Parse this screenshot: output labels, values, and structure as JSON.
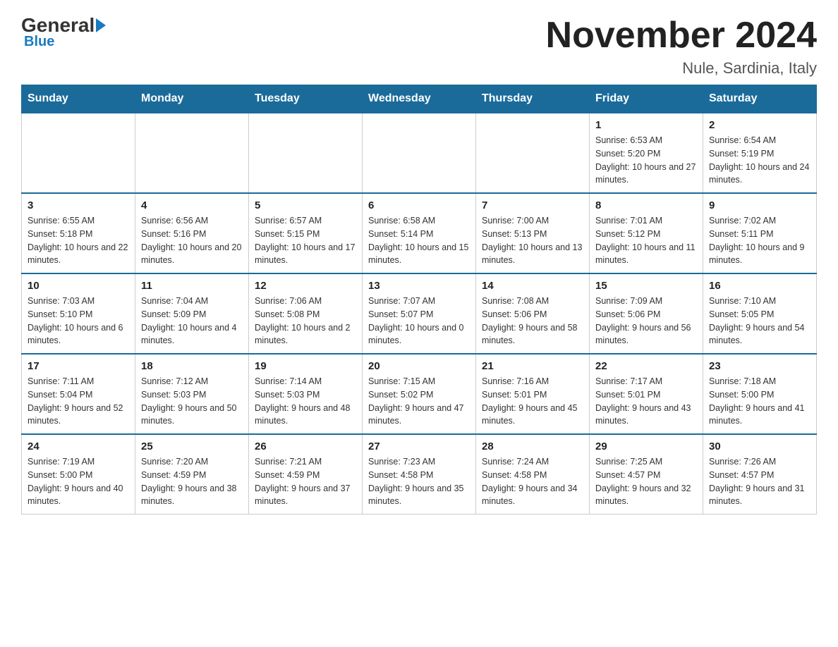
{
  "logo": {
    "general": "General",
    "blue": "Blue"
  },
  "header": {
    "month_year": "November 2024",
    "location": "Nule, Sardinia, Italy"
  },
  "days_of_week": [
    "Sunday",
    "Monday",
    "Tuesday",
    "Wednesday",
    "Thursday",
    "Friday",
    "Saturday"
  ],
  "weeks": [
    {
      "days": [
        {
          "num": "",
          "info": ""
        },
        {
          "num": "",
          "info": ""
        },
        {
          "num": "",
          "info": ""
        },
        {
          "num": "",
          "info": ""
        },
        {
          "num": "",
          "info": ""
        },
        {
          "num": "1",
          "info": "Sunrise: 6:53 AM\nSunset: 5:20 PM\nDaylight: 10 hours and 27 minutes."
        },
        {
          "num": "2",
          "info": "Sunrise: 6:54 AM\nSunset: 5:19 PM\nDaylight: 10 hours and 24 minutes."
        }
      ]
    },
    {
      "days": [
        {
          "num": "3",
          "info": "Sunrise: 6:55 AM\nSunset: 5:18 PM\nDaylight: 10 hours and 22 minutes."
        },
        {
          "num": "4",
          "info": "Sunrise: 6:56 AM\nSunset: 5:16 PM\nDaylight: 10 hours and 20 minutes."
        },
        {
          "num": "5",
          "info": "Sunrise: 6:57 AM\nSunset: 5:15 PM\nDaylight: 10 hours and 17 minutes."
        },
        {
          "num": "6",
          "info": "Sunrise: 6:58 AM\nSunset: 5:14 PM\nDaylight: 10 hours and 15 minutes."
        },
        {
          "num": "7",
          "info": "Sunrise: 7:00 AM\nSunset: 5:13 PM\nDaylight: 10 hours and 13 minutes."
        },
        {
          "num": "8",
          "info": "Sunrise: 7:01 AM\nSunset: 5:12 PM\nDaylight: 10 hours and 11 minutes."
        },
        {
          "num": "9",
          "info": "Sunrise: 7:02 AM\nSunset: 5:11 PM\nDaylight: 10 hours and 9 minutes."
        }
      ]
    },
    {
      "days": [
        {
          "num": "10",
          "info": "Sunrise: 7:03 AM\nSunset: 5:10 PM\nDaylight: 10 hours and 6 minutes."
        },
        {
          "num": "11",
          "info": "Sunrise: 7:04 AM\nSunset: 5:09 PM\nDaylight: 10 hours and 4 minutes."
        },
        {
          "num": "12",
          "info": "Sunrise: 7:06 AM\nSunset: 5:08 PM\nDaylight: 10 hours and 2 minutes."
        },
        {
          "num": "13",
          "info": "Sunrise: 7:07 AM\nSunset: 5:07 PM\nDaylight: 10 hours and 0 minutes."
        },
        {
          "num": "14",
          "info": "Sunrise: 7:08 AM\nSunset: 5:06 PM\nDaylight: 9 hours and 58 minutes."
        },
        {
          "num": "15",
          "info": "Sunrise: 7:09 AM\nSunset: 5:06 PM\nDaylight: 9 hours and 56 minutes."
        },
        {
          "num": "16",
          "info": "Sunrise: 7:10 AM\nSunset: 5:05 PM\nDaylight: 9 hours and 54 minutes."
        }
      ]
    },
    {
      "days": [
        {
          "num": "17",
          "info": "Sunrise: 7:11 AM\nSunset: 5:04 PM\nDaylight: 9 hours and 52 minutes."
        },
        {
          "num": "18",
          "info": "Sunrise: 7:12 AM\nSunset: 5:03 PM\nDaylight: 9 hours and 50 minutes."
        },
        {
          "num": "19",
          "info": "Sunrise: 7:14 AM\nSunset: 5:03 PM\nDaylight: 9 hours and 48 minutes."
        },
        {
          "num": "20",
          "info": "Sunrise: 7:15 AM\nSunset: 5:02 PM\nDaylight: 9 hours and 47 minutes."
        },
        {
          "num": "21",
          "info": "Sunrise: 7:16 AM\nSunset: 5:01 PM\nDaylight: 9 hours and 45 minutes."
        },
        {
          "num": "22",
          "info": "Sunrise: 7:17 AM\nSunset: 5:01 PM\nDaylight: 9 hours and 43 minutes."
        },
        {
          "num": "23",
          "info": "Sunrise: 7:18 AM\nSunset: 5:00 PM\nDaylight: 9 hours and 41 minutes."
        }
      ]
    },
    {
      "days": [
        {
          "num": "24",
          "info": "Sunrise: 7:19 AM\nSunset: 5:00 PM\nDaylight: 9 hours and 40 minutes."
        },
        {
          "num": "25",
          "info": "Sunrise: 7:20 AM\nSunset: 4:59 PM\nDaylight: 9 hours and 38 minutes."
        },
        {
          "num": "26",
          "info": "Sunrise: 7:21 AM\nSunset: 4:59 PM\nDaylight: 9 hours and 37 minutes."
        },
        {
          "num": "27",
          "info": "Sunrise: 7:23 AM\nSunset: 4:58 PM\nDaylight: 9 hours and 35 minutes."
        },
        {
          "num": "28",
          "info": "Sunrise: 7:24 AM\nSunset: 4:58 PM\nDaylight: 9 hours and 34 minutes."
        },
        {
          "num": "29",
          "info": "Sunrise: 7:25 AM\nSunset: 4:57 PM\nDaylight: 9 hours and 32 minutes."
        },
        {
          "num": "30",
          "info": "Sunrise: 7:26 AM\nSunset: 4:57 PM\nDaylight: 9 hours and 31 minutes."
        }
      ]
    }
  ]
}
